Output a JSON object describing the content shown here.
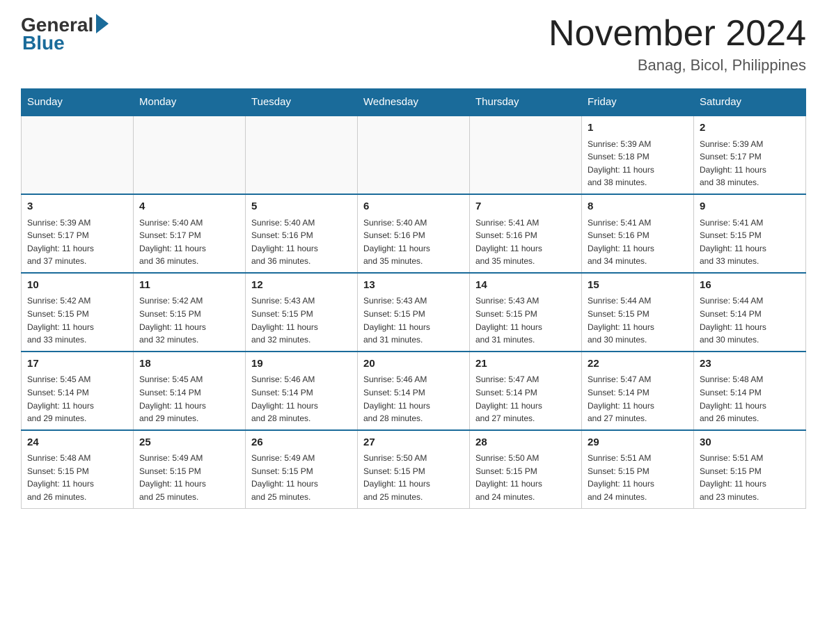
{
  "header": {
    "logo_general": "General",
    "logo_blue": "Blue",
    "month_title": "November 2024",
    "location": "Banag, Bicol, Philippines"
  },
  "days_of_week": [
    "Sunday",
    "Monday",
    "Tuesday",
    "Wednesday",
    "Thursday",
    "Friday",
    "Saturday"
  ],
  "weeks": [
    [
      {
        "day": "",
        "info": ""
      },
      {
        "day": "",
        "info": ""
      },
      {
        "day": "",
        "info": ""
      },
      {
        "day": "",
        "info": ""
      },
      {
        "day": "",
        "info": ""
      },
      {
        "day": "1",
        "info": "Sunrise: 5:39 AM\nSunset: 5:18 PM\nDaylight: 11 hours\nand 38 minutes."
      },
      {
        "day": "2",
        "info": "Sunrise: 5:39 AM\nSunset: 5:17 PM\nDaylight: 11 hours\nand 38 minutes."
      }
    ],
    [
      {
        "day": "3",
        "info": "Sunrise: 5:39 AM\nSunset: 5:17 PM\nDaylight: 11 hours\nand 37 minutes."
      },
      {
        "day": "4",
        "info": "Sunrise: 5:40 AM\nSunset: 5:17 PM\nDaylight: 11 hours\nand 36 minutes."
      },
      {
        "day": "5",
        "info": "Sunrise: 5:40 AM\nSunset: 5:16 PM\nDaylight: 11 hours\nand 36 minutes."
      },
      {
        "day": "6",
        "info": "Sunrise: 5:40 AM\nSunset: 5:16 PM\nDaylight: 11 hours\nand 35 minutes."
      },
      {
        "day": "7",
        "info": "Sunrise: 5:41 AM\nSunset: 5:16 PM\nDaylight: 11 hours\nand 35 minutes."
      },
      {
        "day": "8",
        "info": "Sunrise: 5:41 AM\nSunset: 5:16 PM\nDaylight: 11 hours\nand 34 minutes."
      },
      {
        "day": "9",
        "info": "Sunrise: 5:41 AM\nSunset: 5:15 PM\nDaylight: 11 hours\nand 33 minutes."
      }
    ],
    [
      {
        "day": "10",
        "info": "Sunrise: 5:42 AM\nSunset: 5:15 PM\nDaylight: 11 hours\nand 33 minutes."
      },
      {
        "day": "11",
        "info": "Sunrise: 5:42 AM\nSunset: 5:15 PM\nDaylight: 11 hours\nand 32 minutes."
      },
      {
        "day": "12",
        "info": "Sunrise: 5:43 AM\nSunset: 5:15 PM\nDaylight: 11 hours\nand 32 minutes."
      },
      {
        "day": "13",
        "info": "Sunrise: 5:43 AM\nSunset: 5:15 PM\nDaylight: 11 hours\nand 31 minutes."
      },
      {
        "day": "14",
        "info": "Sunrise: 5:43 AM\nSunset: 5:15 PM\nDaylight: 11 hours\nand 31 minutes."
      },
      {
        "day": "15",
        "info": "Sunrise: 5:44 AM\nSunset: 5:15 PM\nDaylight: 11 hours\nand 30 minutes."
      },
      {
        "day": "16",
        "info": "Sunrise: 5:44 AM\nSunset: 5:14 PM\nDaylight: 11 hours\nand 30 minutes."
      }
    ],
    [
      {
        "day": "17",
        "info": "Sunrise: 5:45 AM\nSunset: 5:14 PM\nDaylight: 11 hours\nand 29 minutes."
      },
      {
        "day": "18",
        "info": "Sunrise: 5:45 AM\nSunset: 5:14 PM\nDaylight: 11 hours\nand 29 minutes."
      },
      {
        "day": "19",
        "info": "Sunrise: 5:46 AM\nSunset: 5:14 PM\nDaylight: 11 hours\nand 28 minutes."
      },
      {
        "day": "20",
        "info": "Sunrise: 5:46 AM\nSunset: 5:14 PM\nDaylight: 11 hours\nand 28 minutes."
      },
      {
        "day": "21",
        "info": "Sunrise: 5:47 AM\nSunset: 5:14 PM\nDaylight: 11 hours\nand 27 minutes."
      },
      {
        "day": "22",
        "info": "Sunrise: 5:47 AM\nSunset: 5:14 PM\nDaylight: 11 hours\nand 27 minutes."
      },
      {
        "day": "23",
        "info": "Sunrise: 5:48 AM\nSunset: 5:14 PM\nDaylight: 11 hours\nand 26 minutes."
      }
    ],
    [
      {
        "day": "24",
        "info": "Sunrise: 5:48 AM\nSunset: 5:15 PM\nDaylight: 11 hours\nand 26 minutes."
      },
      {
        "day": "25",
        "info": "Sunrise: 5:49 AM\nSunset: 5:15 PM\nDaylight: 11 hours\nand 25 minutes."
      },
      {
        "day": "26",
        "info": "Sunrise: 5:49 AM\nSunset: 5:15 PM\nDaylight: 11 hours\nand 25 minutes."
      },
      {
        "day": "27",
        "info": "Sunrise: 5:50 AM\nSunset: 5:15 PM\nDaylight: 11 hours\nand 25 minutes."
      },
      {
        "day": "28",
        "info": "Sunrise: 5:50 AM\nSunset: 5:15 PM\nDaylight: 11 hours\nand 24 minutes."
      },
      {
        "day": "29",
        "info": "Sunrise: 5:51 AM\nSunset: 5:15 PM\nDaylight: 11 hours\nand 24 minutes."
      },
      {
        "day": "30",
        "info": "Sunrise: 5:51 AM\nSunset: 5:15 PM\nDaylight: 11 hours\nand 23 minutes."
      }
    ]
  ]
}
